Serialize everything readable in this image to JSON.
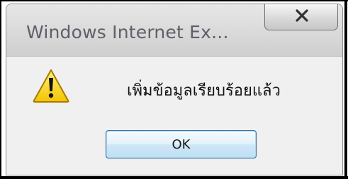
{
  "window": {
    "title": "Windows Internet Ex...",
    "close_label": "close"
  },
  "dialog": {
    "message": "เพิ่มข้อมูลเรียบร้อยแล้ว",
    "icon": "warning-icon",
    "ok_label": "OK"
  },
  "colors": {
    "title_text": "#5f6068",
    "button_border": "#3b6f9a",
    "warning_fill": "#f6d51a"
  }
}
